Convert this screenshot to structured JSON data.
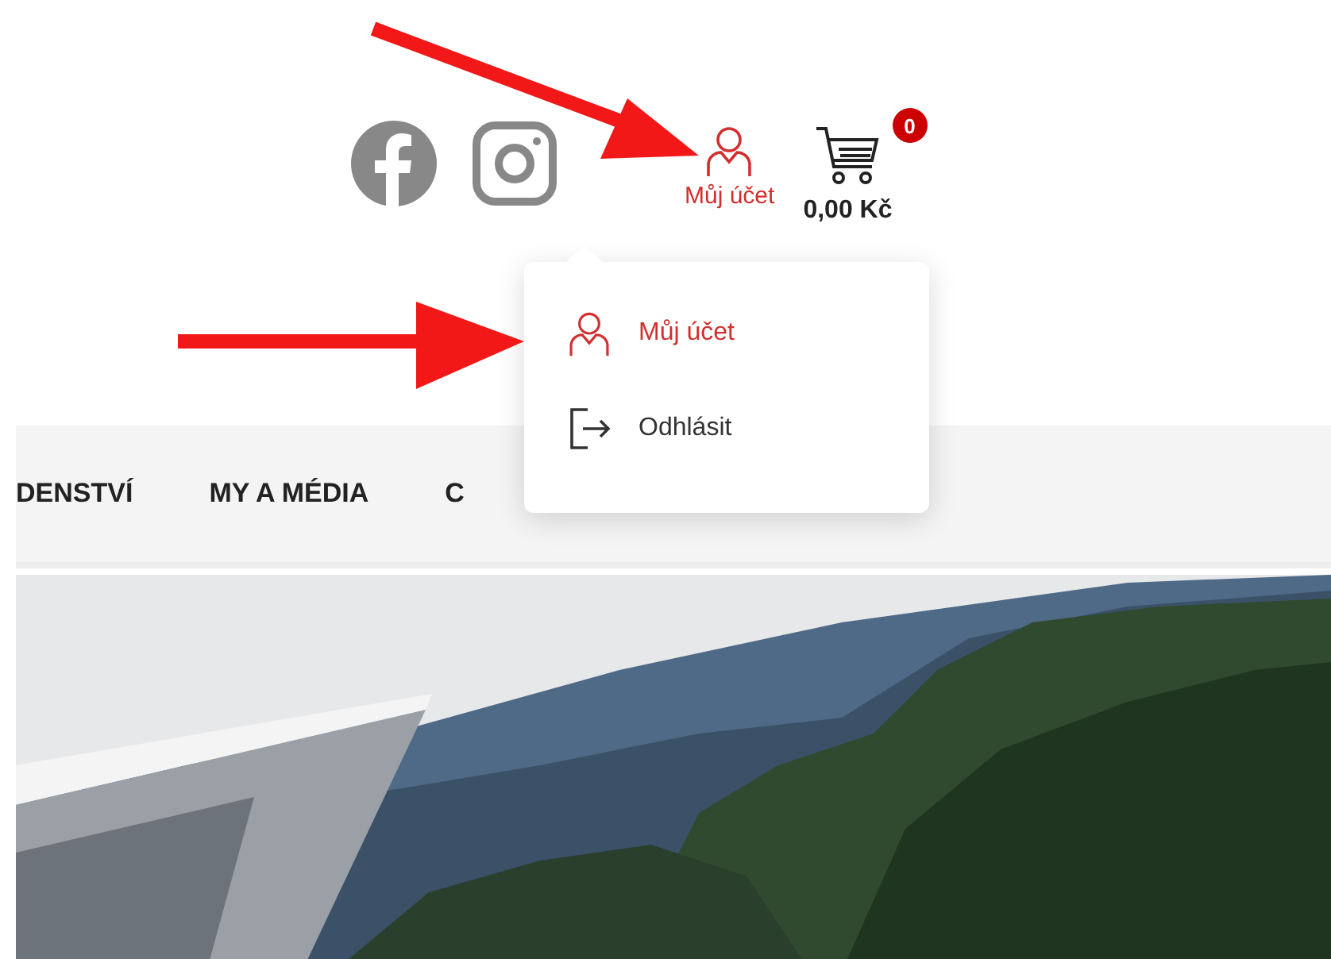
{
  "header": {
    "account": {
      "label": "Můj účet"
    },
    "cart": {
      "badge": "0",
      "total": "0,00 Kč"
    }
  },
  "account_menu": {
    "items": [
      {
        "kind": "account",
        "label": "Můj účet",
        "selected": true
      },
      {
        "kind": "logout",
        "label": "Odhlásit",
        "selected": false
      }
    ]
  },
  "nav": {
    "items": [
      "DENSTVÍ",
      "MY A MÉDIA",
      "C"
    ]
  }
}
